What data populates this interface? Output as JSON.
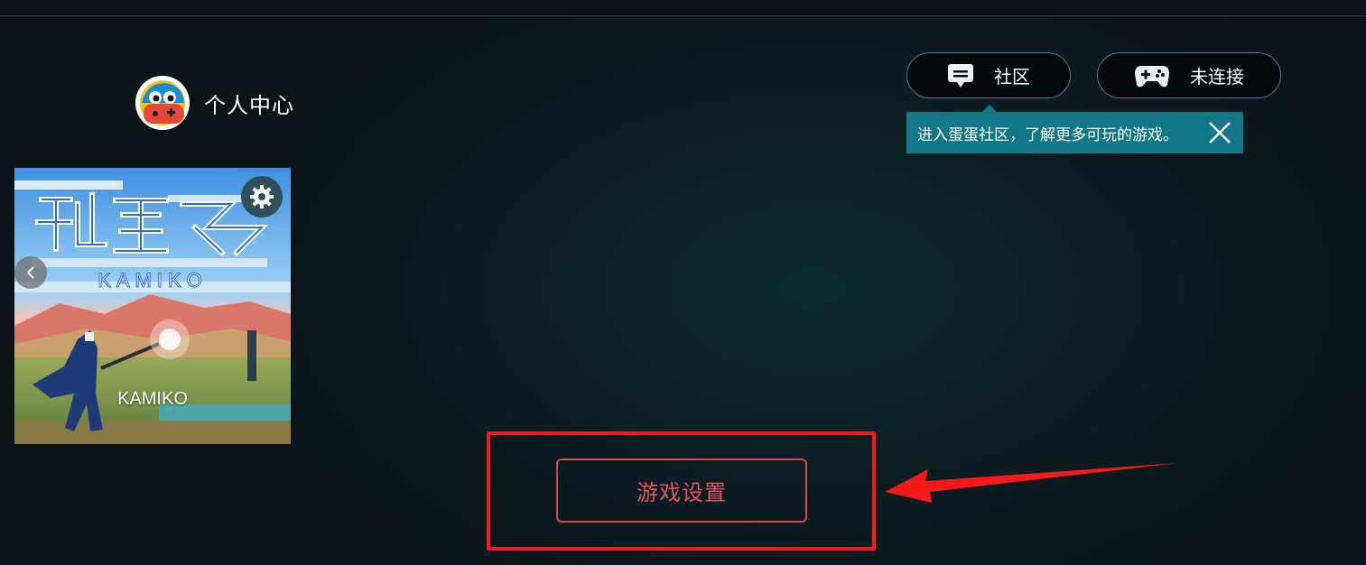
{
  "profile": {
    "label": "个人中心",
    "avatar_icon": "egg-mascot-avatar"
  },
  "header": {
    "community_label": "社区",
    "community_icon": "chat-bubble-icon",
    "connect_label": "未连接",
    "connect_icon": "gamepad-icon"
  },
  "tooltip": {
    "text": "进入蛋蛋社区，了解更多可玩的游戏。",
    "close_icon": "close-icon"
  },
  "game": {
    "name": "KAMIKO",
    "logo_text": "KAMIKO",
    "settings_icon": "gear-icon",
    "prev_icon": "chevron-left-icon"
  },
  "actions": {
    "settings_label": "游戏设置"
  },
  "colors": {
    "accent_red": "#e2545e",
    "highlight_red": "#f21a1a",
    "tooltip_bg": "#127786",
    "pill_border": "#4d7e8a"
  }
}
